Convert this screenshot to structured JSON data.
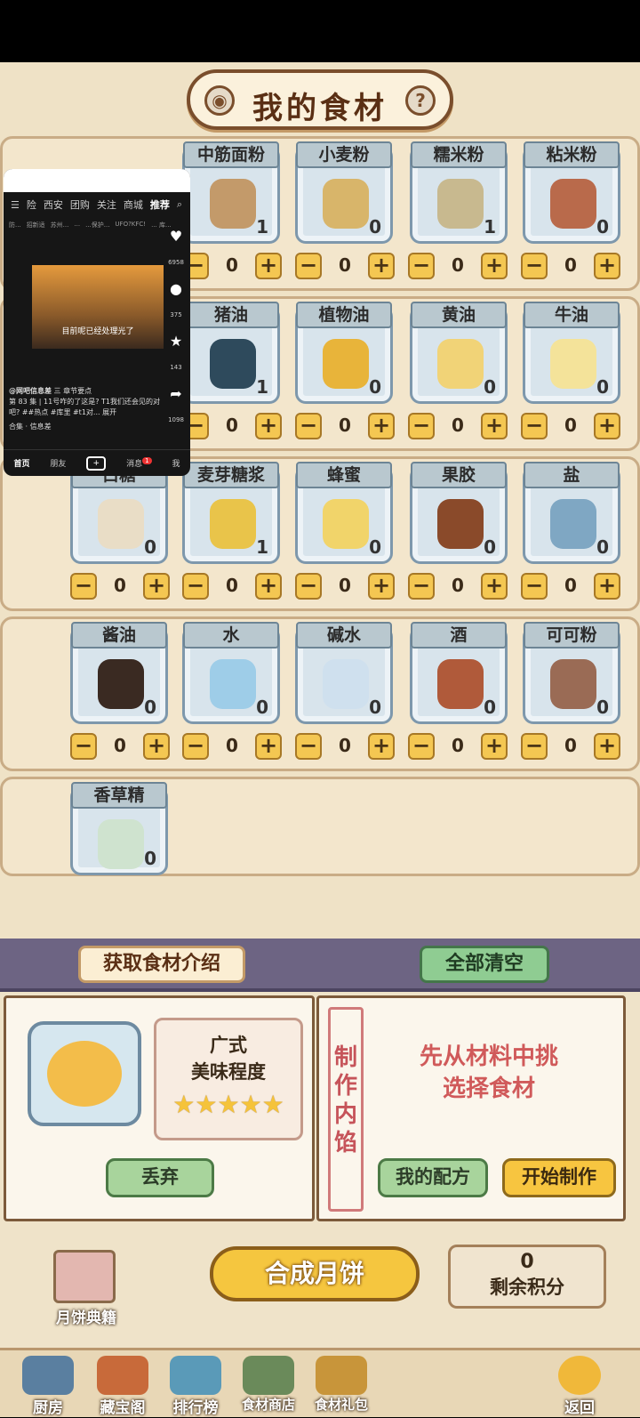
{
  "header": {
    "title": "我的食材",
    "help": "?"
  },
  "rows": [
    [
      {
        "name": "中筋面粉",
        "count": "1",
        "value": "0",
        "color": "#c39a6a"
      },
      {
        "name": "小麦粉",
        "count": "0",
        "value": "0",
        "color": "#d8b56a"
      },
      {
        "name": "糯米粉",
        "count": "1",
        "value": "0",
        "color": "#c8b98f"
      },
      {
        "name": "粘米粉",
        "count": "0",
        "value": "0",
        "color": "#b96a4b"
      }
    ],
    [
      {
        "name": "猪油",
        "count": "1",
        "value": "0",
        "color": "#2e4a5c"
      },
      {
        "name": "植物油",
        "count": "0",
        "value": "0",
        "color": "#e8b43a"
      },
      {
        "name": "黄油",
        "count": "0",
        "value": "0",
        "color": "#f1d377"
      },
      {
        "name": "牛油",
        "count": "0",
        "value": "0",
        "color": "#f4e39a"
      }
    ],
    [
      {
        "name": "白糖",
        "count": "0",
        "value": "0",
        "color": "#e9ddc6"
      },
      {
        "name": "麦芽糖浆",
        "count": "1",
        "value": "0",
        "color": "#e9c44a"
      },
      {
        "name": "蜂蜜",
        "count": "0",
        "value": "0",
        "color": "#f1d46a"
      },
      {
        "name": "果胶",
        "count": "0",
        "value": "0",
        "color": "#8a4a2a"
      },
      {
        "name": "盐",
        "count": "0",
        "value": "0",
        "color": "#7fa7c3"
      }
    ],
    [
      {
        "name": "酱油",
        "count": "0",
        "value": "0",
        "color": "#3a2a22"
      },
      {
        "name": "水",
        "count": "0",
        "value": "0",
        "color": "#9ecde8"
      },
      {
        "name": "碱水",
        "count": "0",
        "value": "0",
        "color": "#cfe0ee"
      },
      {
        "name": "酒",
        "count": "0",
        "value": "0",
        "color": "#b05a3a"
      },
      {
        "name": "可可粉",
        "count": "0",
        "value": "0",
        "color": "#9a6b55"
      }
    ],
    [
      {
        "name": "香草精",
        "count": "0",
        "value": "0",
        "color": "#cfe3cf"
      }
    ]
  ],
  "overlay": {
    "nav": [
      "险",
      "西安",
      "团购",
      "关注",
      "商城",
      "推荐"
    ],
    "tags": [
      "防...",
      "招新适",
      "苏州...",
      "...",
      "...保护...",
      "UFO?KFC!",
      "... 库..."
    ],
    "caption": "目前呢已经处理光了",
    "stats": [
      "6958",
      "375",
      "143",
      "1098"
    ],
    "user": "@网吧信息差",
    "chapter": "三 章节要点",
    "desc": "第 83 集 | 11号咋的了这是? T1我们还会见的对吧? ##热点 #库里 #t1对... 展开",
    "collection": "合集 · 信息差",
    "tabs": [
      "首页",
      "朋友",
      "消息",
      "我"
    ],
    "badge": "1"
  },
  "lower": {
    "intro_label": "获取食材介绍",
    "clear_label": "全部清空",
    "style": "广式",
    "taste": "美味程度",
    "discard": "丢弃",
    "filling_label": "制作内馅",
    "prompt": "先从材料中挑选择食材",
    "recipe": "我的配方",
    "start": "开始制作",
    "compose": "合成月饼",
    "points": "0",
    "points_label": "剩余积分",
    "book": "月饼典籍"
  },
  "nav": [
    {
      "label": "厨房",
      "color": "#5a7fa0"
    },
    {
      "label": "藏宝阁",
      "color": "#c86a3a"
    },
    {
      "label": "排行榜",
      "color": "#5a9ab8"
    },
    {
      "label": "食材商店",
      "color": "#6a8a5a"
    },
    {
      "label": "食材礼包",
      "color": "#c8953a"
    },
    {
      "label": "返回",
      "color": "#f0b83a"
    }
  ]
}
